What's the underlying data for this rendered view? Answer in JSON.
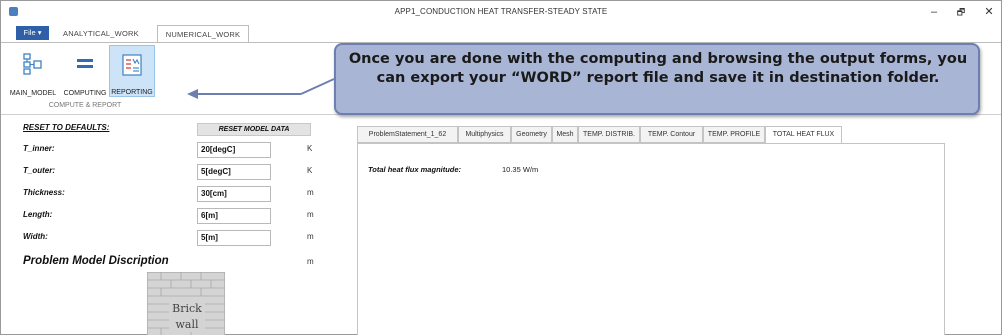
{
  "window": {
    "title": "APP1_CONDUCTION HEAT TRANSFER-STEADY STATE",
    "minimize": "–",
    "maximize": "🗗",
    "close": "✕"
  },
  "ribbon": {
    "file_label": "File ▾",
    "tabs": [
      {
        "label": "ANALYTICAL_WORK",
        "active": false
      },
      {
        "label": "NUMERICAL_WORK",
        "active": true
      }
    ],
    "buttons": [
      {
        "label": "MAIN_MODEL",
        "icon": "main-model-icon"
      },
      {
        "label": "COMPUTING",
        "icon": "computing-icon"
      },
      {
        "label": "REPORTING",
        "icon": "reporting-icon",
        "selected": true
      }
    ],
    "group_label": "COMPUTE & REPORT"
  },
  "callout": {
    "text": "Once you are done with the computing and browsing the output forms, you can export your “WORD” report file and save it in destination folder."
  },
  "params": {
    "reset_defaults": "RESET TO DEFAULTS:",
    "reset_model": "RESET MODEL DATA",
    "rows": [
      {
        "label": "T_inner:",
        "value": "20[degC]",
        "unit": "K"
      },
      {
        "label": "T_outer:",
        "value": "5[degC]",
        "unit": "K"
      },
      {
        "label": "Thickness:",
        "value": "30[cm]",
        "unit": "m"
      },
      {
        "label": "Length:",
        "value": "6[m]",
        "unit": "m"
      },
      {
        "label": "Width:",
        "value": "5[m]",
        "unit": "m"
      }
    ],
    "description_title": "Problem Model Discription",
    "description_unit": "m",
    "image_text": [
      "Brick",
      "wall"
    ]
  },
  "results": {
    "tabs": [
      {
        "label": "ProblemStatement_1_62",
        "active": false
      },
      {
        "label": "Multiphysics",
        "active": false
      },
      {
        "label": "Geometry",
        "active": false
      },
      {
        "label": "Mesh",
        "active": false
      },
      {
        "label": "TEMP. DISTRIB.",
        "active": false
      },
      {
        "label": "TEMP. Contour",
        "active": false
      },
      {
        "label": "TEMP. PROFILE",
        "active": false
      },
      {
        "label": "TOTAL HEAT FLUX",
        "active": true
      }
    ],
    "heat_flux_label": "Total heat flux magnitude:",
    "heat_flux_value": "10.35 W/m"
  },
  "colors": {
    "file_tab": "#2e5fa8",
    "callout_fill": "#a9b5d4",
    "callout_border": "#6d7fb1",
    "selected_button": "#cde3f7"
  }
}
